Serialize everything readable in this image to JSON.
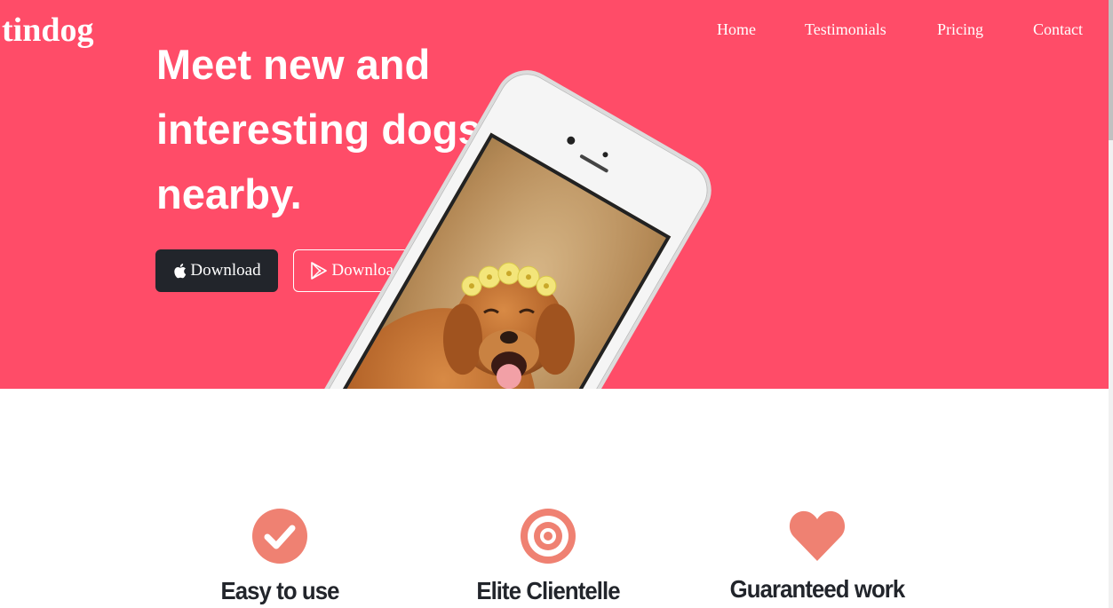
{
  "nav": {
    "brand": "tindog",
    "links": [
      "Home",
      "Testimonials",
      "Pricing",
      "Contact"
    ]
  },
  "hero": {
    "heading": "Meet new and interesting dogs nearby.",
    "buttons": [
      {
        "label": "Download",
        "icon": "apple-icon"
      },
      {
        "label": "Download",
        "icon": "google-play-icon"
      }
    ],
    "image": "phone showing a golden retriever wearing a flower crown"
  },
  "features": [
    {
      "title": "Easy to use",
      "icon": "check-circle-icon"
    },
    {
      "title": "Elite Clientelle",
      "icon": "bullseye-icon"
    },
    {
      "title": "Guaranteed work",
      "icon": "heart-icon"
    }
  ],
  "colors": {
    "hero_bg": "#ff4c68",
    "icon_accent": "#ef8172",
    "dark": "#22252b",
    "text_light": "#ffffff"
  }
}
